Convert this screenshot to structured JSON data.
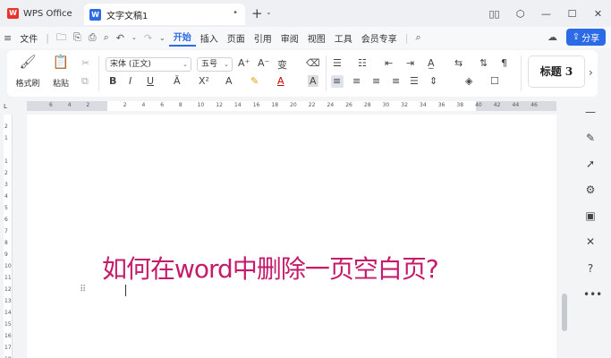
{
  "titlebar": {
    "app_tab": "WPS Office",
    "app_logo": "W",
    "doc_tab": "文字文稿1",
    "doc_logo": "W",
    "close_glyph": "•",
    "new_tab": "+",
    "new_tab_dd": "⌄",
    "icons": [
      "columns-icon",
      "cube-icon",
      "minimize-icon",
      "restore-icon",
      "close-icon"
    ]
  },
  "menubar": {
    "file_label": "文件",
    "items": [
      "开始",
      "插入",
      "页面",
      "引用",
      "审阅",
      "视图",
      "工具",
      "会员专享"
    ],
    "active": "开始",
    "share_label": "分享"
  },
  "ribbon": {
    "format_painter": "格式刷",
    "paste": "粘贴",
    "font_name": "宋体 (正文)",
    "font_size": "五号",
    "bold": "B",
    "italic": "I",
    "underline": "U",
    "heading_style": "标题 3"
  },
  "ruler": {
    "ticks": [
      "6",
      "4",
      "2",
      "",
      "2",
      "4",
      "6",
      "8",
      "10",
      "12",
      "14",
      "16",
      "18",
      "20",
      "22",
      "24",
      "26",
      "28",
      "30",
      "32",
      "34",
      "36",
      "38",
      "40",
      "42",
      "44",
      "46"
    ],
    "corner": "L",
    "vticks": [
      "2",
      "1",
      "",
      "1",
      "2",
      "3",
      "4",
      "5",
      "6",
      "7",
      "8",
      "9",
      "10",
      "11",
      "12",
      "13",
      "14",
      "15",
      "16",
      "17",
      "18"
    ]
  },
  "document": {
    "title": "如何在word中删除一页空白页?"
  },
  "colors": {
    "accent": "#2d6ae5",
    "title_text": "#c41b6a",
    "wps_red": "#e8332b"
  }
}
